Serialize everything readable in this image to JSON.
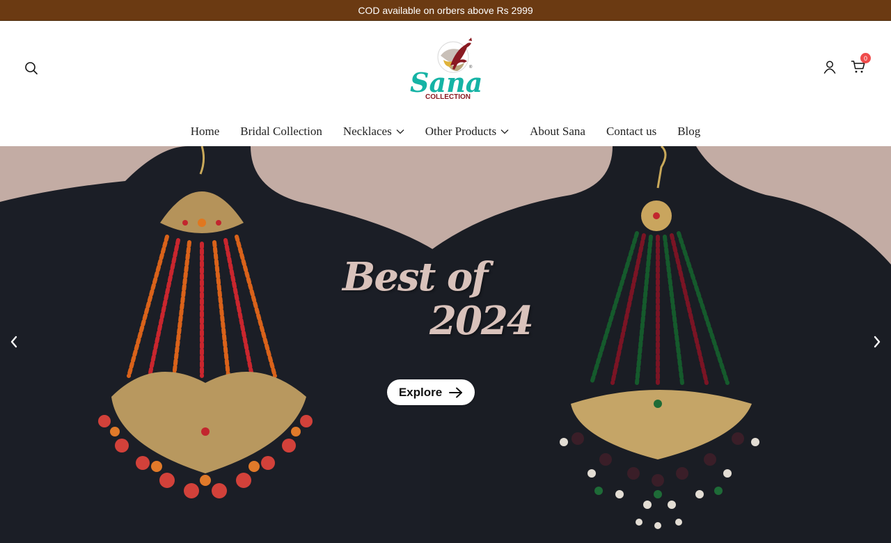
{
  "announcement": {
    "text": "COD available on orbers above Rs 2999"
  },
  "header": {
    "logo": {
      "brand": "Sana",
      "sub": "COLLECTION",
      "mark": "®"
    },
    "icons": {
      "search": "search-icon",
      "account": "user-icon",
      "cart": "cart-icon"
    },
    "cart_count": "0"
  },
  "nav": {
    "items": [
      {
        "label": "Home",
        "dropdown": false
      },
      {
        "label": "Bridal Collection",
        "dropdown": false
      },
      {
        "label": "Necklaces",
        "dropdown": true
      },
      {
        "label": "Other Products",
        "dropdown": true
      },
      {
        "label": "About Sana",
        "dropdown": false
      },
      {
        "label": "Contact us",
        "dropdown": false
      },
      {
        "label": "Blog",
        "dropdown": false
      }
    ]
  },
  "hero": {
    "headline_line1": "Best of",
    "headline_line2": "2024",
    "cta_label": "Explore",
    "colors": {
      "backdrop": "#c3aca4",
      "display": "#1a1d24",
      "headline": "#d9c2bb"
    }
  },
  "colors": {
    "announcement_bg": "#6b3a12",
    "badge": "#ef4b4b"
  }
}
